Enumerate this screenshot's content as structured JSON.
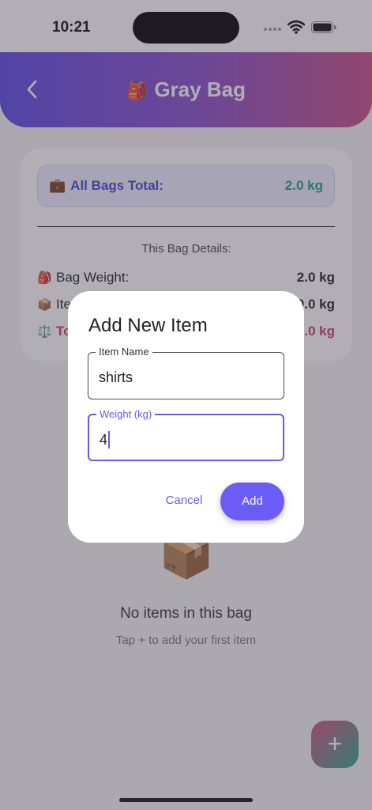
{
  "status_bar": {
    "time": "10:21",
    "icons": [
      "signal-icon",
      "wifi-icon",
      "battery-icon"
    ]
  },
  "header": {
    "back_icon": "chevron-left-icon",
    "title_emoji": "🎒",
    "title": "Gray Bag"
  },
  "summary": {
    "total_emoji": "💼",
    "total_label": "All Bags Total:",
    "total_value": "2.0 kg",
    "details_title": "This Bag Details:",
    "rows": [
      {
        "emoji": "🎒",
        "label": "Bag Weight:",
        "value": "2.0 kg"
      },
      {
        "emoji": "📦",
        "label": "Items Weight:",
        "value": "0.0 kg"
      },
      {
        "emoji": "⚖️",
        "label": "Total:",
        "value": "2.0 kg"
      }
    ]
  },
  "empty_state": {
    "emoji": "📦",
    "title": "No items in this bag",
    "subtitle": "Tap + to add your first item"
  },
  "fab": {
    "label": "+"
  },
  "dialog": {
    "title": "Add New Item",
    "item_name": {
      "label": "Item Name",
      "value": "shirts"
    },
    "weight": {
      "label": "Weight (kg)",
      "value": "4"
    },
    "cancel_label": "Cancel",
    "add_label": "Add"
  },
  "colors": {
    "accent": "#6b5cf5",
    "header_start": "#5b49e6",
    "header_end": "#c94e86",
    "total_value": "#1aa089",
    "total_row": "#d6336c"
  }
}
